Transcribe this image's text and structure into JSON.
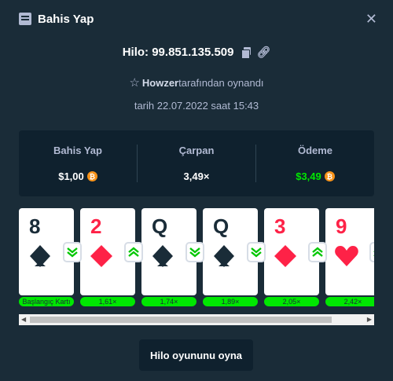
{
  "header": {
    "title": "Bahis Yap",
    "close": "✕",
    "title_icon": "bet-slip-icon"
  },
  "game": {
    "id_text": "Hilo: 99.851.135.509",
    "copy_icon": "copy-icon",
    "link_icon": "link-icon"
  },
  "player": {
    "name": "Howzer",
    "suffix": "tarafından oynandı"
  },
  "date": "tarih 22.07.2022 saat 15:43",
  "stats": {
    "bet": {
      "label": "Bahis Yap",
      "value": "$1,00"
    },
    "multiplier": {
      "label": "Çarpan",
      "value": "3,49×"
    },
    "payout": {
      "label": "Ödeme",
      "value": "$3,49"
    },
    "currency_symbol": "₿"
  },
  "cards": [
    {
      "rank": "8",
      "suit": "spade",
      "color": "black",
      "mult": "Başlangıç Kartı",
      "arrow": "down"
    },
    {
      "rank": "2",
      "suit": "diamond",
      "color": "red",
      "mult": "1,61×",
      "arrow": "up"
    },
    {
      "rank": "Q",
      "suit": "spade",
      "color": "black",
      "mult": "1,74×",
      "arrow": "down"
    },
    {
      "rank": "Q",
      "suit": "spade",
      "color": "black",
      "mult": "1,89×",
      "arrow": "down"
    },
    {
      "rank": "3",
      "suit": "diamond",
      "color": "red",
      "mult": "2,05×",
      "arrow": "up"
    },
    {
      "rank": "9",
      "suit": "heart",
      "color": "red",
      "mult": "2,42×",
      "arrow": "up"
    }
  ],
  "colors": {
    "background": "#1a2c38",
    "panel": "#0f212e",
    "green": "#00e701",
    "red": "#fe2247"
  },
  "play_button": "Hilo oyununu oyna"
}
